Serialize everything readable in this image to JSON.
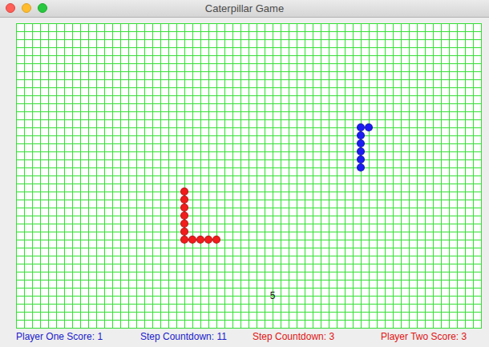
{
  "window": {
    "title": "Caterpillar Game"
  },
  "caterpillars": [
    {
      "player": "one",
      "color": "#1c1cf2",
      "segments": [
        {
          "x": 43,
          "y": 13
        },
        {
          "x": 44,
          "y": 13
        },
        {
          "x": 43,
          "y": 14
        },
        {
          "x": 43,
          "y": 15
        },
        {
          "x": 43,
          "y": 16
        },
        {
          "x": 43,
          "y": 17
        },
        {
          "x": 43,
          "y": 18
        }
      ]
    },
    {
      "player": "two",
      "color": "#f21c1c",
      "segments": [
        {
          "x": 21,
          "y": 21
        },
        {
          "x": 21,
          "y": 22
        },
        {
          "x": 21,
          "y": 23
        },
        {
          "x": 21,
          "y": 24
        },
        {
          "x": 21,
          "y": 25
        },
        {
          "x": 21,
          "y": 26
        },
        {
          "x": 21,
          "y": 27
        },
        {
          "x": 22,
          "y": 27
        },
        {
          "x": 23,
          "y": 27
        },
        {
          "x": 24,
          "y": 27
        },
        {
          "x": 25,
          "y": 27
        }
      ]
    }
  ],
  "countdown": {
    "text": "5",
    "x": 32,
    "y": 34
  },
  "status_bar": [
    {
      "text": "Player One Score: 1",
      "color": "#1a1acc"
    },
    {
      "text": "Step Countdown: 11",
      "color": "#1a1acc"
    },
    {
      "text": "Step Countdown: 3",
      "color": "#e01414"
    },
    {
      "text": "Player Two Score: 3",
      "color": "#e01414"
    }
  ]
}
